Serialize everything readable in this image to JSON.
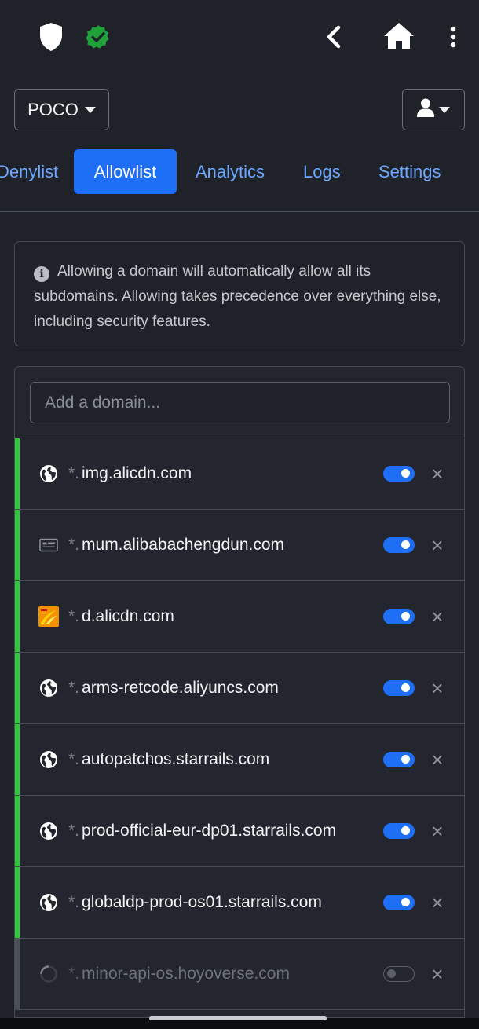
{
  "topbar": {
    "icons": [
      "shield-icon",
      "verified-badge-icon",
      "back-chevron-icon",
      "home-icon",
      "more-vert-icon"
    ],
    "verified_color": "#1fa23a"
  },
  "profile": {
    "name": "POCO"
  },
  "user_menu": {
    "icon": "user-icon"
  },
  "tabs": [
    {
      "label": "Denylist",
      "active": false
    },
    {
      "label": "Allowlist",
      "active": true
    },
    {
      "label": "Analytics",
      "active": false
    },
    {
      "label": "Logs",
      "active": false
    },
    {
      "label": "Settings",
      "active": false
    }
  ],
  "info": {
    "icon": "info-icon",
    "text": "Allowing a domain will automatically allow all its subdomains. Allowing takes precedence over everything else, including security features."
  },
  "allowlist": {
    "add_placeholder": "Add a domain...",
    "add_value": "",
    "wildcard": "*.",
    "items": [
      {
        "domain": "img.alicdn.com",
        "favicon": "globe-icon",
        "enabled": true
      },
      {
        "domain": "mum.alibabachengdun.com",
        "favicon": "card-icon",
        "enabled": true
      },
      {
        "domain": "d.alicdn.com",
        "favicon": "alicdn-logo-icon",
        "enabled": true
      },
      {
        "domain": "arms-retcode.aliyuncs.com",
        "favicon": "globe-icon",
        "enabled": true
      },
      {
        "domain": "autopatchos.starrails.com",
        "favicon": "globe-icon",
        "enabled": true
      },
      {
        "domain": "prod-official-eur-dp01.starrails.com",
        "favicon": "globe-icon",
        "enabled": true
      },
      {
        "domain": "globaldp-prod-os01.starrails.com",
        "favicon": "globe-icon",
        "enabled": true
      },
      {
        "domain": "minor-api-os.hoyoverse.com",
        "favicon": "loading-spinner-icon",
        "enabled": false
      }
    ],
    "enabled_color": "#2fc83a",
    "toggle_color": "#1e6ff5"
  }
}
